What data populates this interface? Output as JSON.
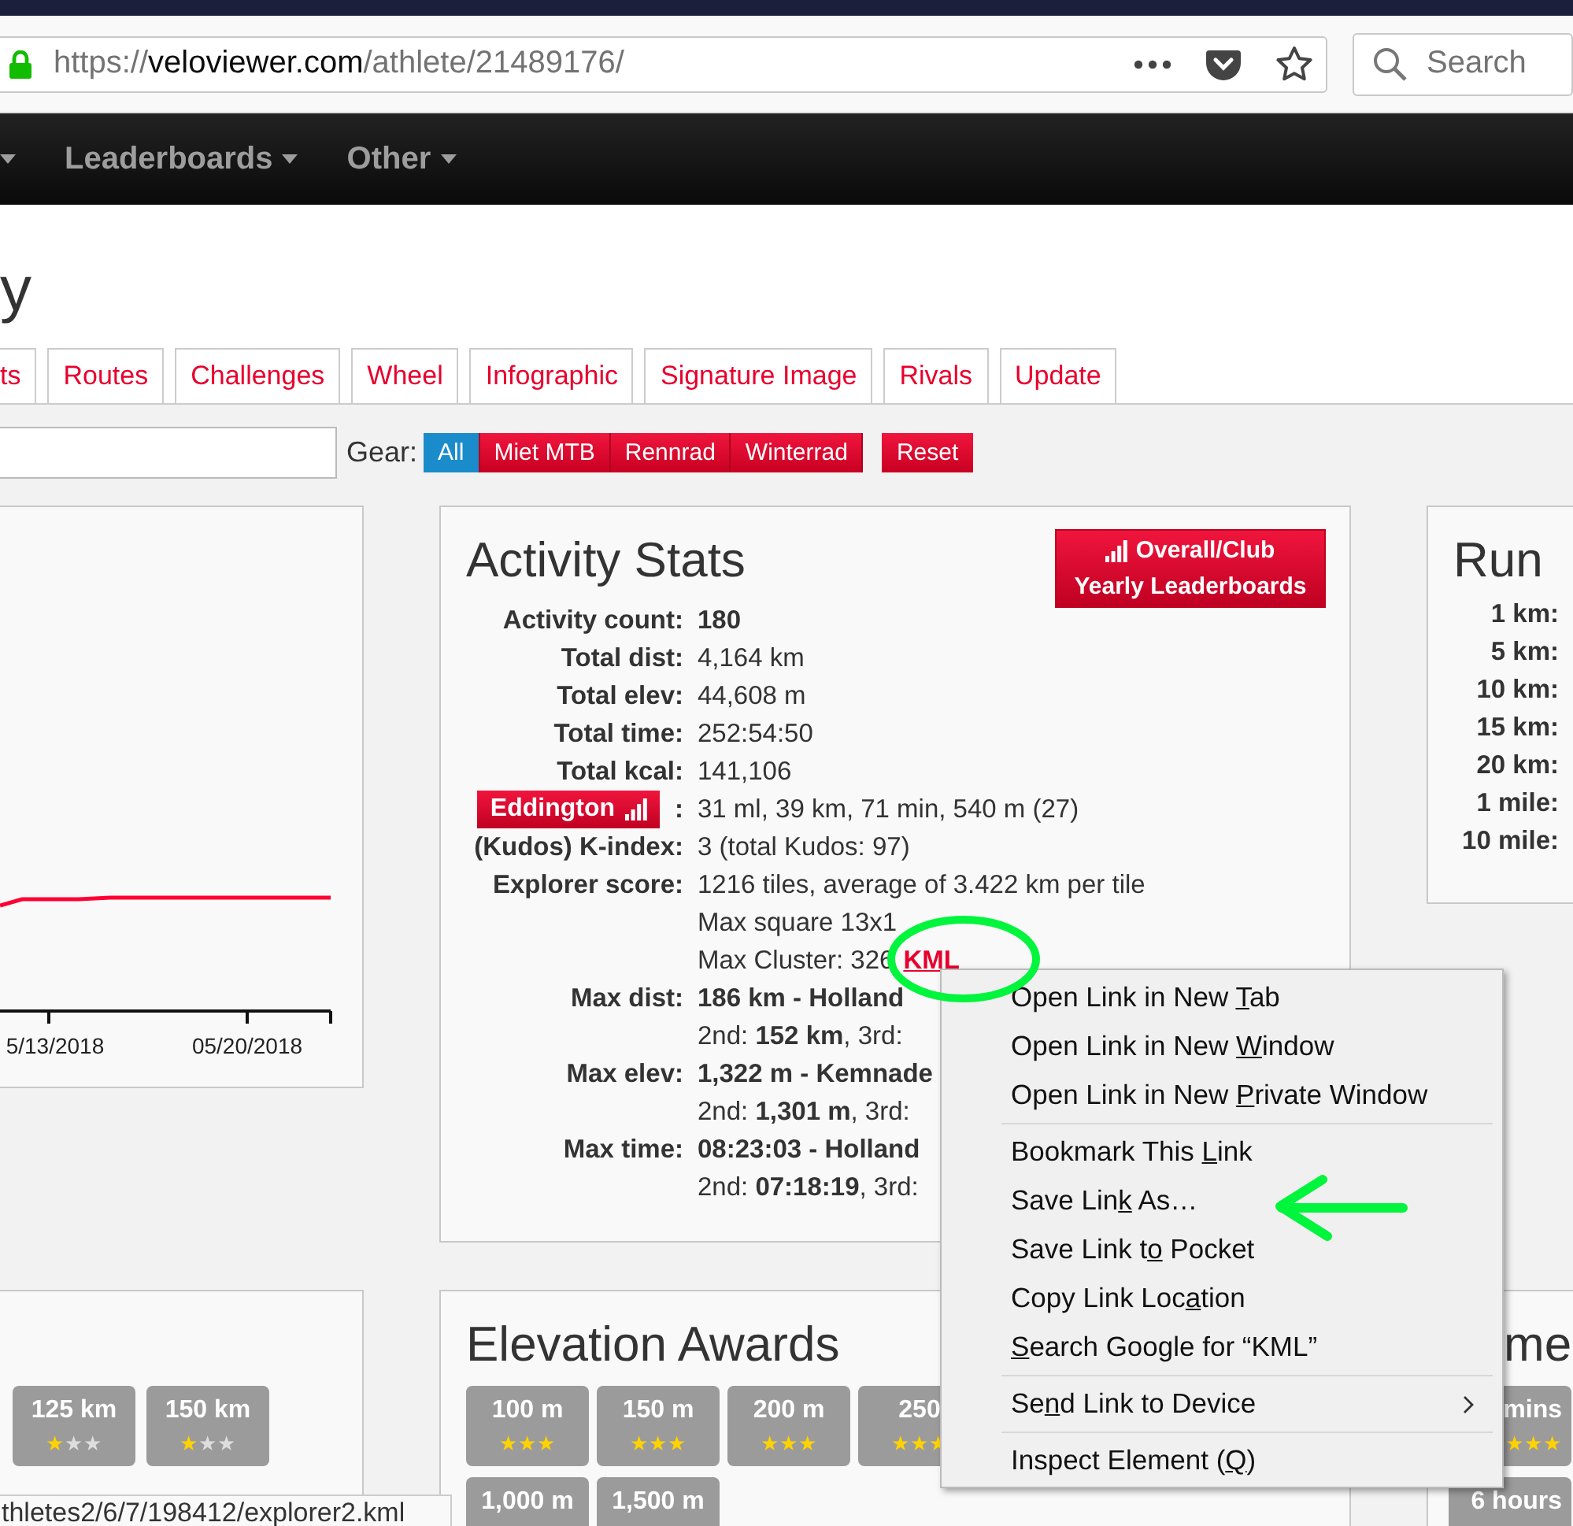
{
  "browser": {
    "url": {
      "scheme": "https://",
      "host": "veloviewer.com",
      "path": "/athlete/21489176/"
    },
    "search": {
      "placeholder": "Search"
    }
  },
  "nav": {
    "leading_caret": true,
    "items": [
      {
        "label": "Leaderboards"
      },
      {
        "label": "Other"
      }
    ]
  },
  "page_title": "y",
  "tabs": [
    {
      "label": "ts",
      "selected": false
    },
    {
      "label": "Routes",
      "selected": false
    },
    {
      "label": "Challenges",
      "selected": false
    },
    {
      "label": "Wheel",
      "selected": false
    },
    {
      "label": "Infographic",
      "selected": false
    },
    {
      "label": "Signature Image",
      "selected": false
    },
    {
      "label": "Rivals",
      "selected": false
    },
    {
      "label": "Update",
      "selected": false
    }
  ],
  "gear": {
    "label": "Gear:",
    "options": [
      {
        "label": "All",
        "selected": true
      },
      {
        "label": "Miet MTB",
        "selected": false
      },
      {
        "label": "Rennrad",
        "selected": false
      },
      {
        "label": "Winterrad",
        "selected": false
      }
    ],
    "reset": "Reset"
  },
  "chart_panel": {
    "x_labels": [
      "5/13/2018",
      "05/20/2018"
    ]
  },
  "activity_stats": {
    "title": "Activity Stats",
    "leaderboards_button": [
      "Overall/Club",
      "Yearly Leaderboards"
    ],
    "rows": [
      {
        "kind": "stat",
        "label": "Activity count:",
        "values": [
          {
            "text": "**180**"
          }
        ]
      },
      {
        "kind": "stat",
        "label": "Total dist:",
        "values": [
          {
            "text": "4,164 km"
          }
        ]
      },
      {
        "kind": "stat",
        "label": "Total elev:",
        "values": [
          {
            "text": "44,608 m"
          }
        ]
      },
      {
        "kind": "stat",
        "label": "Total time:",
        "values": [
          {
            "text": "252:54:50"
          }
        ]
      },
      {
        "kind": "stat",
        "label": "Total kcal:",
        "values": [
          {
            "text": "141,106"
          }
        ]
      },
      {
        "kind": "button",
        "label": "Eddington",
        "suffix": ":",
        "values": [
          {
            "text": "31 ml, 39 km, 71 min, 540 m (27)"
          }
        ]
      },
      {
        "kind": "stat",
        "label": "(Kudos) K-index:",
        "values": [
          {
            "text": "3 (total Kudos: 97)"
          }
        ]
      },
      {
        "kind": "stat",
        "label": "Explorer score:",
        "values": [
          {
            "text": "1216 tiles, average of 3.422 km per tile"
          },
          {
            "text": "Max square 13x1"
          },
          {
            "text": "Max Cluster: 326",
            "link": "KML"
          }
        ]
      },
      {
        "kind": "stat",
        "label": "Max dist:",
        "values": [
          {
            "text": "**186 km - Holland**"
          },
          {
            "text": "2nd: **152 km**, 3rd:"
          }
        ]
      },
      {
        "kind": "stat",
        "label": "Max elev:",
        "values": [
          {
            "text": "**1,322 m - Kemnade**"
          },
          {
            "text": "2nd: **1,301 m**, 3rd:"
          }
        ]
      },
      {
        "kind": "stat",
        "label": "Max time:",
        "values": [
          {
            "text": "**08:23:03 - Holland**"
          },
          {
            "text": "2nd: **07:18:19**, 3rd:"
          }
        ]
      }
    ]
  },
  "run_panel": {
    "title": "Run",
    "rows": [
      "1 km:",
      "5 km:",
      "10 km:",
      "15 km:",
      "20 km:",
      "1 mile:",
      "10 mile:"
    ]
  },
  "distance_awards": {
    "badges": [
      {
        "label": "125 km",
        "stars": 1
      },
      {
        "label": "150 km",
        "stars": 1
      }
    ]
  },
  "elevation_awards": {
    "title": "Elevation Awards",
    "badges": [
      {
        "label": "100 m",
        "stars": 3
      },
      {
        "label": "150 m",
        "stars": 3
      },
      {
        "label": "200 m",
        "stars": 3
      },
      {
        "label": "250",
        "stars": 3
      },
      {
        "label": "1,000 m"
      },
      {
        "label": "1,500 m"
      }
    ]
  },
  "time_awards": {
    "title": "me",
    "badges": [
      {
        "label": "mins",
        "stars": 3
      },
      {
        "label": "6 hours"
      }
    ]
  },
  "context_menu": {
    "groups": [
      [
        {
          "before": "Open Link in New ",
          "key": "T",
          "after": "ab"
        },
        {
          "before": "Open Link in New ",
          "key": "W",
          "after": "indow"
        },
        {
          "before": "Open Link in New ",
          "key": "P",
          "after": "rivate Window"
        }
      ],
      [
        {
          "before": "Bookmark This ",
          "key": "L",
          "after": "ink"
        },
        {
          "before": "Save Lin",
          "key": "k",
          "after": " As…"
        },
        {
          "before": "Save Link t",
          "key": "o",
          "after": " Pocket"
        },
        {
          "before": "Copy Link Loc",
          "key": "a",
          "after": "tion"
        },
        {
          "key": "S",
          "after": "earch Google for “KML”"
        }
      ],
      [
        {
          "before": "Se",
          "key": "n",
          "after": "d Link to Device",
          "submenu": true
        }
      ],
      [
        {
          "before": "Inspect Element (",
          "key": "Q",
          "after": ")"
        }
      ]
    ]
  },
  "status_url": "thletes2/6/7/198412/explorer2.kml",
  "annotations": [
    {
      "kind": "circle"
    },
    {
      "kind": "arrow"
    }
  ]
}
